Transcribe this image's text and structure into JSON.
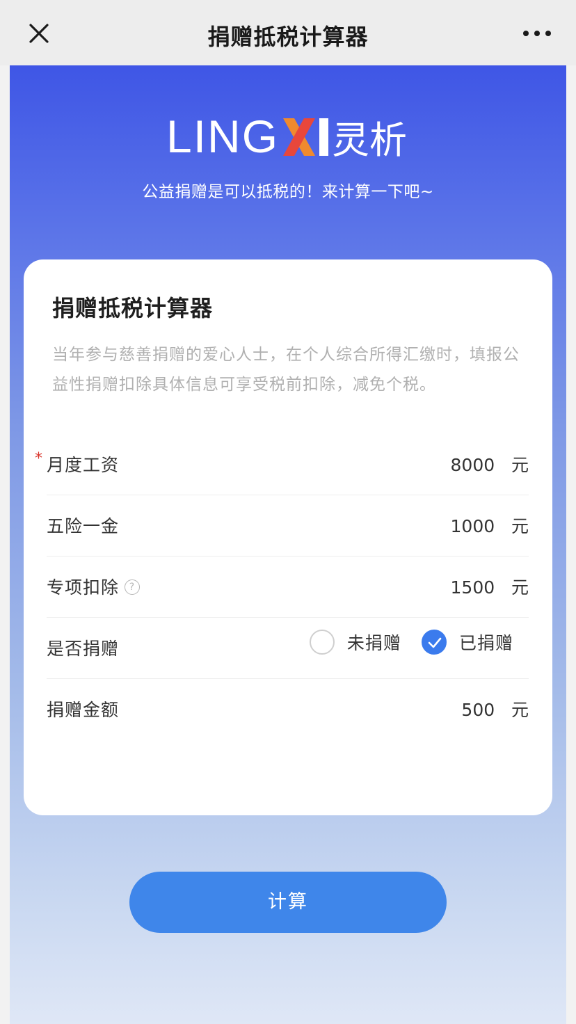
{
  "topbar": {
    "title": "捐赠抵税计算器",
    "close_icon": "close-icon",
    "more_icon": "more-dots-icon"
  },
  "header": {
    "logo_text": "LINGXI灵析",
    "tagline": "公益捐赠是可以抵税的！来计算一下吧~"
  },
  "card": {
    "title": "捐赠抵税计算器",
    "description": "当年参与慈善捐赠的爱心人士，在个人综合所得汇缴时，填报公益性捐赠扣除具体信息可享受税前扣除，减免个税。",
    "fields": {
      "salary": {
        "label": "月度工资",
        "required_mark": "*",
        "value": "8000",
        "unit": "元"
      },
      "insurance": {
        "label": "五险一金",
        "value": "1000",
        "unit": "元"
      },
      "special": {
        "label": "专项扣除",
        "help": "?",
        "value": "1500",
        "unit": "元"
      },
      "donated": {
        "label": "是否捐赠",
        "options": [
          {
            "label": "未捐赠",
            "checked": false
          },
          {
            "label": "已捐赠",
            "checked": true
          }
        ]
      },
      "donation": {
        "label": "捐赠金额",
        "value": "500",
        "unit": "元"
      }
    }
  },
  "actions": {
    "calculate_label": "计算"
  },
  "colors": {
    "primary": "#3f86ea",
    "header_gradient_top": "#3f56e6",
    "required": "#d9342b",
    "logo_orange": "#f08a2e",
    "logo_red": "#e8473b"
  }
}
